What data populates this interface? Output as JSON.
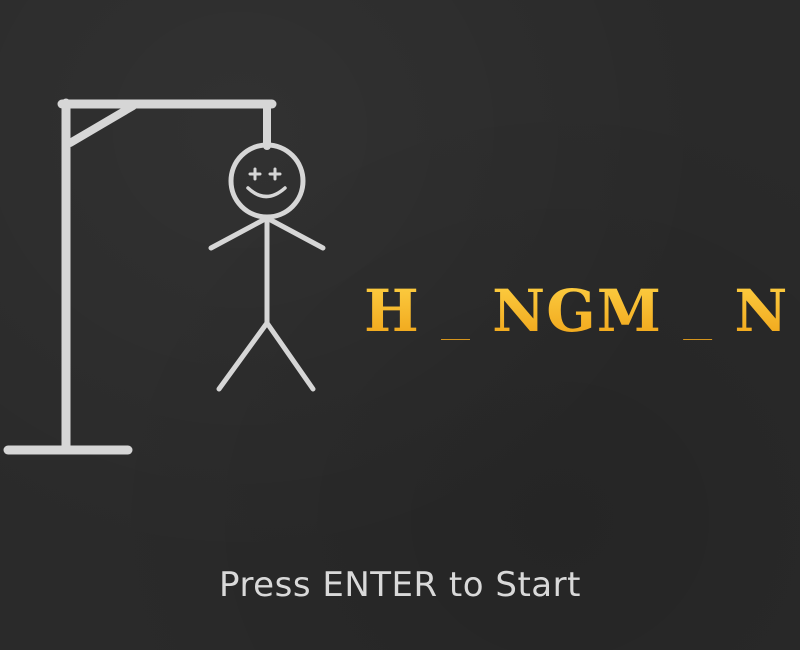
{
  "game": {
    "title_text": "H _ NGM _ N",
    "prompt_text": "Press ENTER to Start"
  },
  "colors": {
    "background": "#2a2a2a",
    "chalk": "#d6d6d6",
    "title_gold": "#f2b51c",
    "prompt": "#d9d9d9"
  }
}
